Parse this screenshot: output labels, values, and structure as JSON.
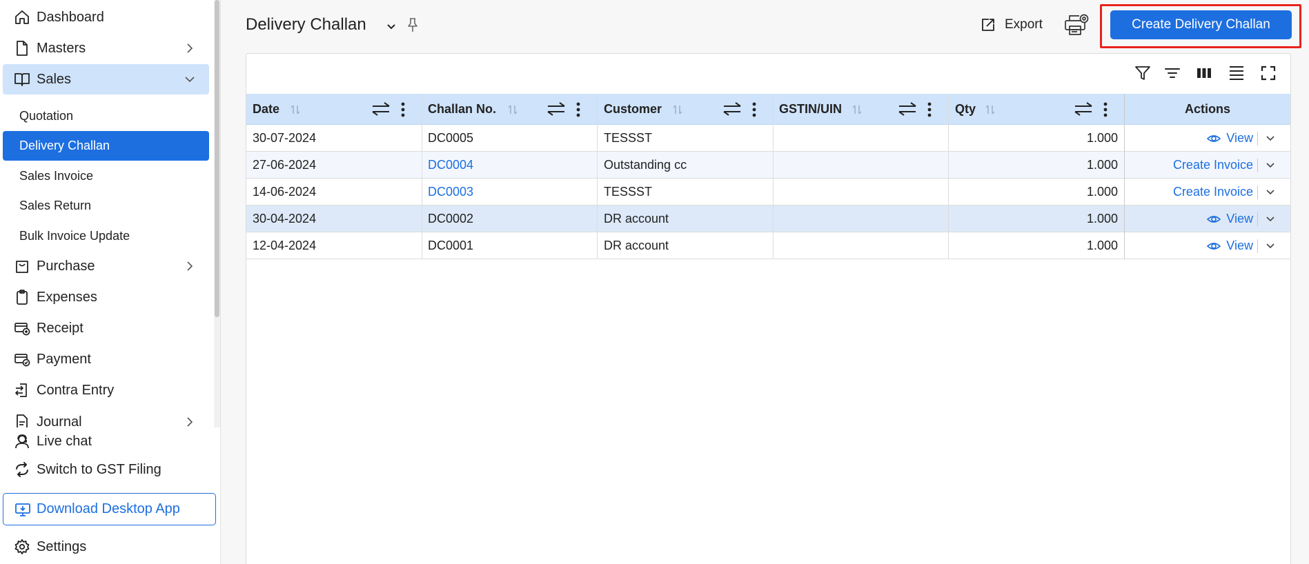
{
  "sidebar": {
    "items": [
      {
        "label": "Dashboard",
        "icon": "home-icon"
      },
      {
        "label": "Masters",
        "icon": "document-icon"
      },
      {
        "label": "Sales",
        "icon": "book-icon"
      },
      {
        "label": "Purchase",
        "icon": "shopping-bag-icon"
      },
      {
        "label": "Expenses",
        "icon": "clipboard-icon"
      },
      {
        "label": "Receipt",
        "icon": "receipt-icon"
      },
      {
        "label": "Payment",
        "icon": "payment-icon"
      },
      {
        "label": "Contra Entry",
        "icon": "contra-entry-icon"
      },
      {
        "label": "Journal",
        "icon": "journal-icon"
      }
    ],
    "sales_sub": [
      "Quotation",
      "Delivery Challan",
      "Sales Invoice",
      "Sales Return",
      "Bulk Invoice Update"
    ],
    "active_sub": "Delivery Challan",
    "live_chat": "Live chat",
    "switch_gst": "Switch to GST Filing",
    "download_app": "Download Desktop App",
    "settings": "Settings"
  },
  "header": {
    "title": "Delivery Challan",
    "export_label": "Export",
    "create_label": "Create Delivery Challan"
  },
  "table": {
    "columns": [
      "Date",
      "Challan No.",
      "Customer",
      "GSTIN/UIN",
      "Qty",
      "Actions"
    ],
    "rows": [
      {
        "date": "30-07-2024",
        "challan": "DC0005",
        "customer": "TESSST",
        "gstin": "",
        "qty": "1.000",
        "action": "View"
      },
      {
        "date": "27-06-2024",
        "challan": "DC0004",
        "customer": "Outstanding cc",
        "gstin": "",
        "qty": "1.000",
        "action": "Create Invoice"
      },
      {
        "date": "14-06-2024",
        "challan": "DC0003",
        "customer": "TESSST",
        "gstin": "",
        "qty": "1.000",
        "action": "Create Invoice"
      },
      {
        "date": "30-04-2024",
        "challan": "DC0002",
        "customer": "DR account",
        "gstin": "",
        "qty": "1.000",
        "action": "View"
      },
      {
        "date": "12-04-2024",
        "challan": "DC0001",
        "customer": "DR account",
        "gstin": "",
        "qty": "1.000",
        "action": "View"
      }
    ]
  },
  "colors": {
    "primary": "#1d6fe0",
    "header_row": "#cfe3fb",
    "highlight": "#e8231c"
  }
}
